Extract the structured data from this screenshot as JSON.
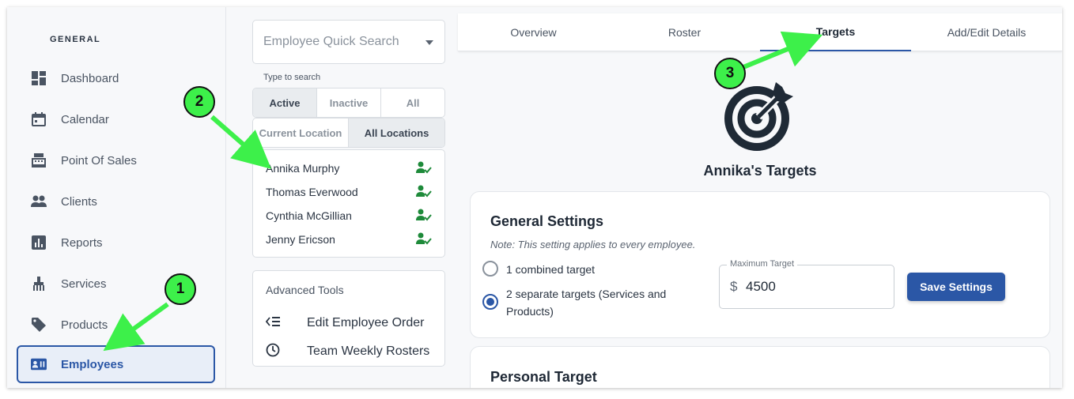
{
  "sidebar": {
    "section_title": "GENERAL",
    "items": [
      {
        "label": "Dashboard",
        "icon": "dashboard-icon"
      },
      {
        "label": "Calendar",
        "icon": "calendar-icon"
      },
      {
        "label": "Point Of Sales",
        "icon": "cash-register-icon"
      },
      {
        "label": "Clients",
        "icon": "people-icon"
      },
      {
        "label": "Reports",
        "icon": "bar-chart-icon"
      },
      {
        "label": "Services",
        "icon": "services-icon"
      },
      {
        "label": "Products",
        "icon": "tag-icon"
      },
      {
        "label": "Employees",
        "icon": "id-card-icon",
        "active": true
      }
    ]
  },
  "employee_panel": {
    "search_placeholder": "Employee Quick Search",
    "hint": "Type to search",
    "status_filter": [
      "Active",
      "Inactive",
      "All"
    ],
    "status_selected": "Active",
    "location_filter": [
      "Current Location",
      "All Locations"
    ],
    "location_selected": "All Locations",
    "employees": [
      "Annika Murphy",
      "Thomas Everwood",
      "Cynthia McGillian",
      "Jenny Ericson"
    ],
    "advanced_tools": {
      "title": "Advanced Tools",
      "items": [
        {
          "label": "Edit Employee Order",
          "icon": "reorder-list-icon"
        },
        {
          "label": "Team Weekly Rosters",
          "icon": "clock-icon"
        }
      ]
    }
  },
  "tabs": [
    "Overview",
    "Roster",
    "Targets",
    "Add/Edit Details"
  ],
  "active_tab": "Targets",
  "targets": {
    "title": "Annika's Targets",
    "general": {
      "heading": "General Settings",
      "note": "Note: This setting applies to every employee.",
      "options": [
        "1 combined target",
        "2 separate targets (Services and Products)"
      ],
      "selected_option": 1,
      "max_target_label": "Maximum Target",
      "currency": "$",
      "max_target_value": "4500",
      "save_label": "Save Settings"
    },
    "personal": {
      "heading": "Personal Target"
    }
  },
  "annotations": [
    "1",
    "2",
    "3"
  ],
  "colors": {
    "accent": "#2b57a6",
    "annotation": "#3df04a",
    "check": "#1e8a3a"
  }
}
